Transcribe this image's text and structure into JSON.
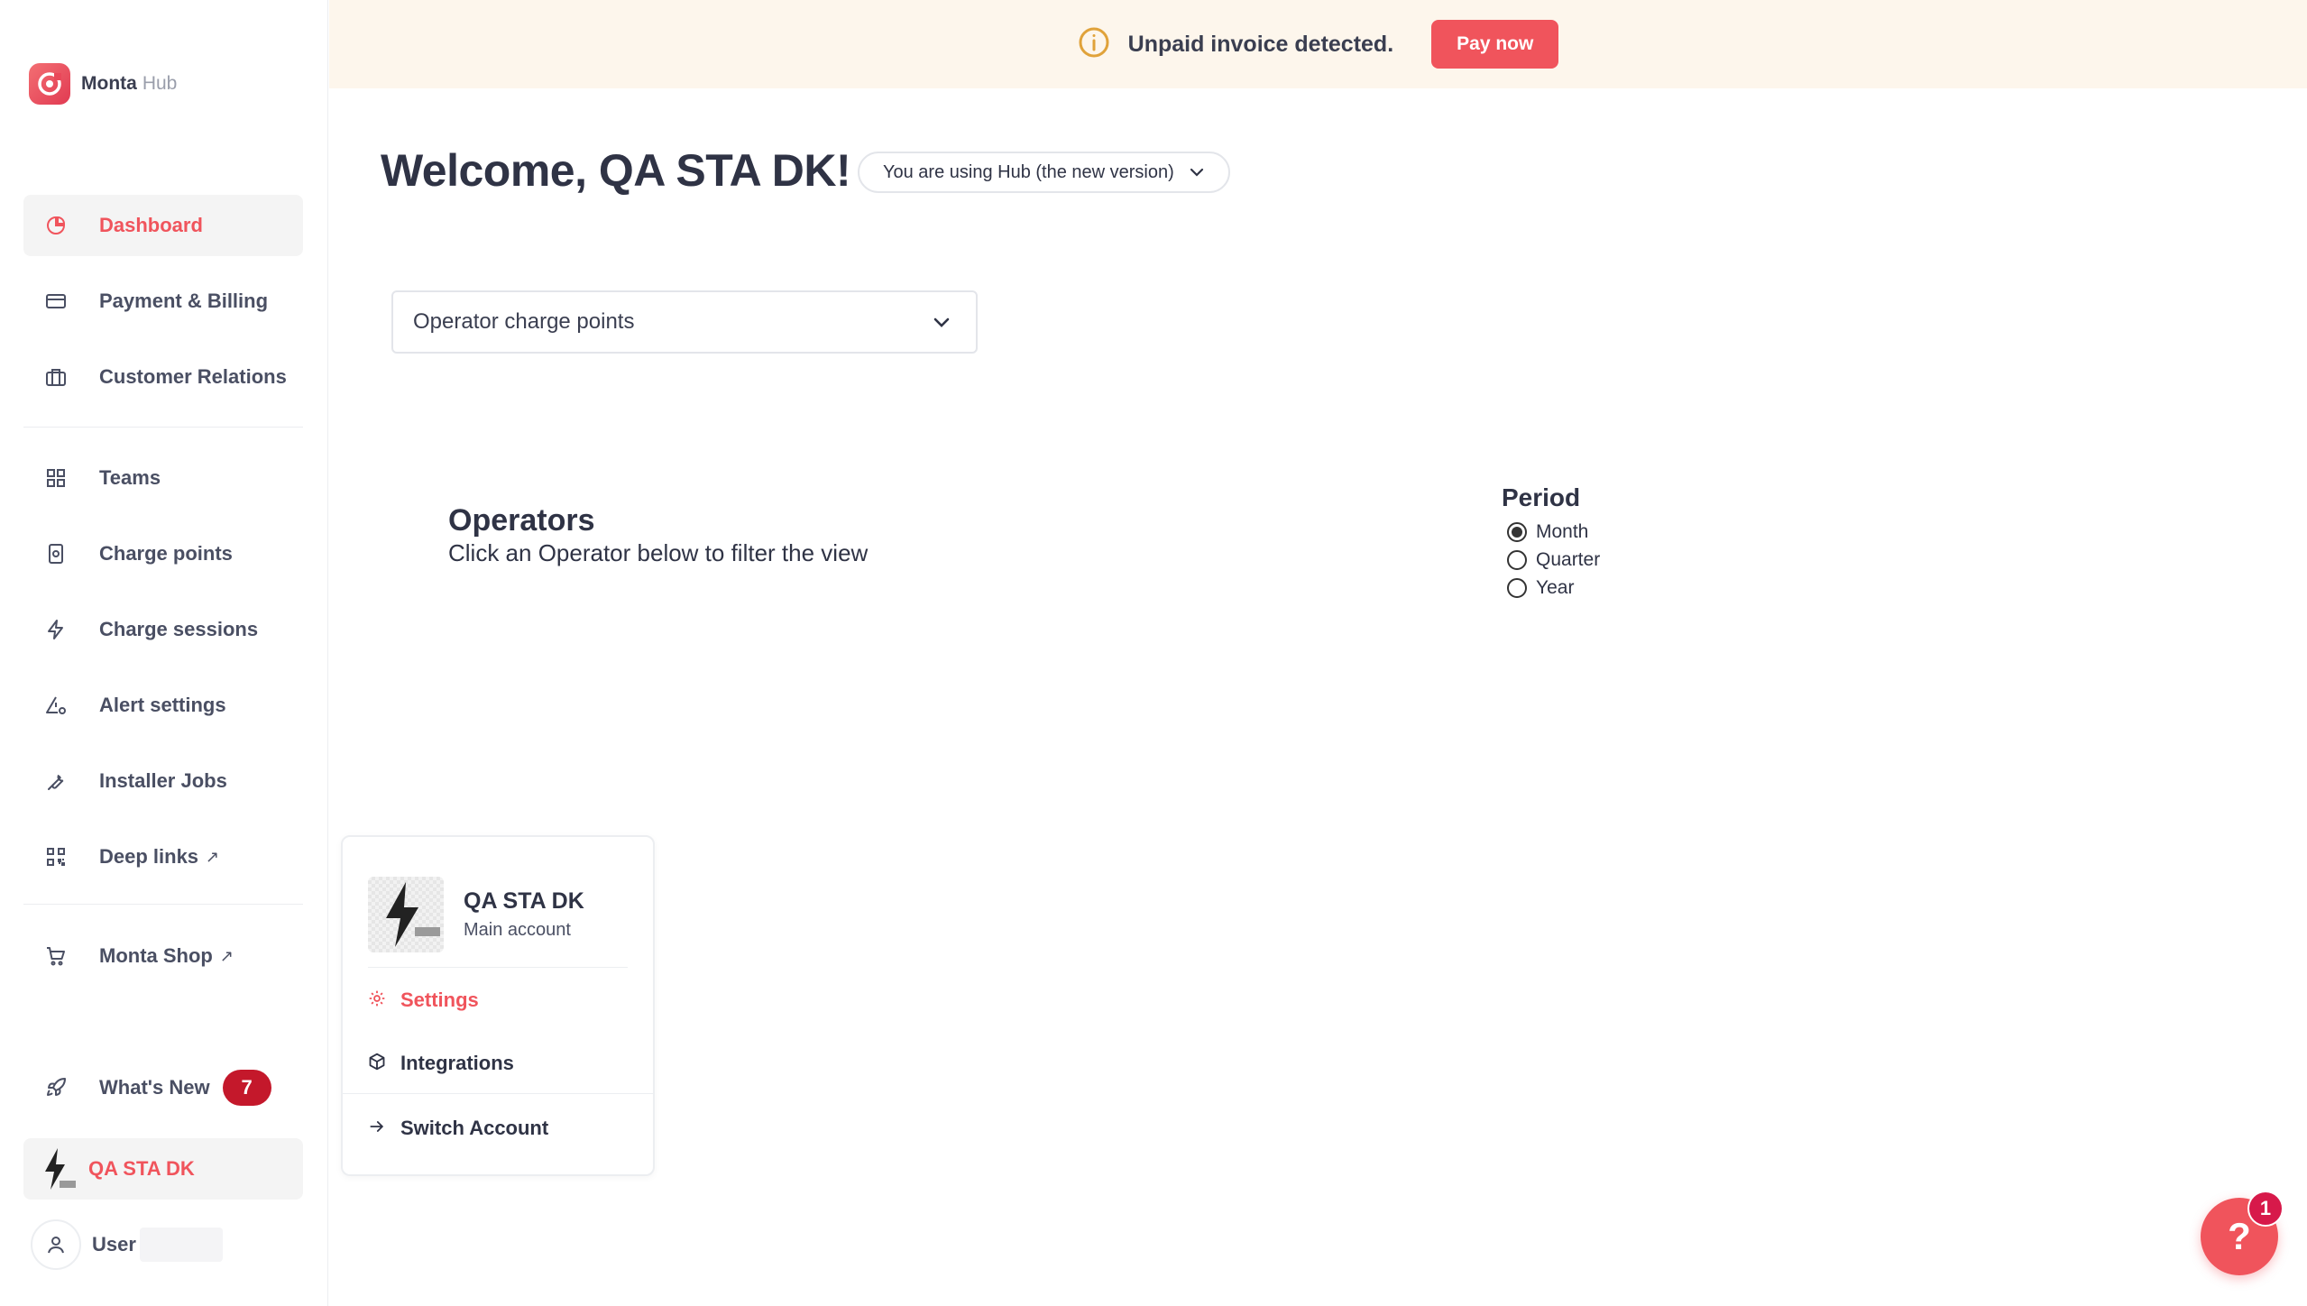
{
  "brand": {
    "name": "Monta",
    "sub": "Hub"
  },
  "sidebar": {
    "items": [
      {
        "label": "Dashboard",
        "icon": "pie-chart-icon",
        "active": true
      },
      {
        "label": "Payment & Billing",
        "icon": "credit-card-icon"
      },
      {
        "label": "Customer Relations",
        "icon": "briefcase-icon"
      },
      {
        "label": "Teams",
        "icon": "grid-icon"
      },
      {
        "label": "Charge points",
        "icon": "charge-point-icon"
      },
      {
        "label": "Charge sessions",
        "icon": "lightning-icon"
      },
      {
        "label": "Alert settings",
        "icon": "alert-gear-icon"
      },
      {
        "label": "Installer Jobs",
        "icon": "wrench-icon"
      },
      {
        "label": "Deep links",
        "icon": "qr-code-icon",
        "external": true
      },
      {
        "label": "Monta Shop",
        "icon": "cart-icon",
        "external": true
      }
    ],
    "whats_new": {
      "label": "What's New",
      "count": "7"
    },
    "account": {
      "label": "QA STA DK"
    },
    "user": {
      "label": "User"
    }
  },
  "banner": {
    "message": "Unpaid invoice detected.",
    "button": "Pay now"
  },
  "main": {
    "welcome": "Welcome, QA STA DK!",
    "version": "You are using Hub (the new version)",
    "select_value": "Operator charge points",
    "operators_title": "Operators",
    "operators_subtitle": "Click an Operator below to filter the view",
    "period": {
      "title": "Period",
      "options": [
        "Month",
        "Quarter",
        "Year"
      ],
      "selected": "Month"
    }
  },
  "popup": {
    "name": "QA STA DK",
    "role": "Main account",
    "items": [
      "Settings",
      "Integrations",
      "Switch Account"
    ]
  },
  "help": {
    "symbol": "?",
    "count": "1"
  },
  "colors": {
    "accent": "#f0545c",
    "badge": "#c4182b",
    "banner_bg": "#fdf6ec",
    "info": "#e0a23a"
  }
}
